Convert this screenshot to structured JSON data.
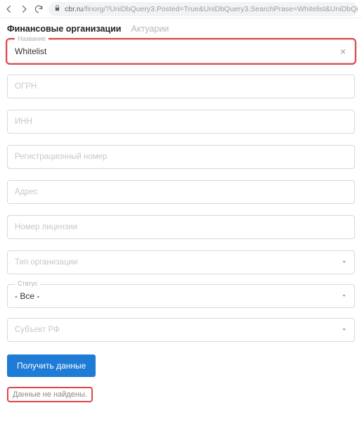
{
  "browser": {
    "url_host": "cbr.ru",
    "url_path": "/finorg/?UniDbQuery3.Posted=True&UniDbQuery3.SearchPrase=Whitelist&UniDbQuery3.Searc"
  },
  "tabs": {
    "active": "Финансовые организации",
    "inactive": "Актуарии"
  },
  "fields": {
    "name": {
      "label": "Название",
      "value": "Whitelist"
    },
    "ogrn": {
      "placeholder": "ОГРН"
    },
    "inn": {
      "placeholder": "ИНН"
    },
    "regnum": {
      "placeholder": "Регистрационный номер"
    },
    "address": {
      "placeholder": "Адрес"
    },
    "license": {
      "placeholder": "Номер лицензии"
    },
    "orgtype": {
      "placeholder": "Тип организации"
    },
    "status": {
      "label": "Статус",
      "value": "- Все -"
    },
    "region": {
      "placeholder": "Субъект РФ"
    }
  },
  "submit_label": "Получить данные",
  "result_message": "Данные не найдены."
}
